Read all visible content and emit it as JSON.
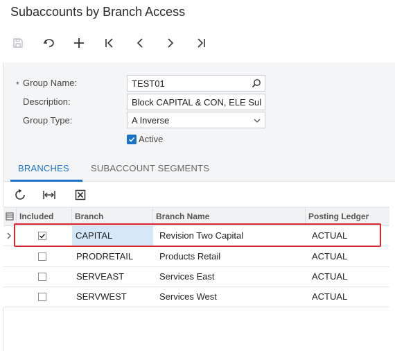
{
  "page": {
    "title": "Subaccounts by Branch Access"
  },
  "toolbar": {
    "buttons": [
      {
        "name": "save-icon",
        "enabled": false
      },
      {
        "name": "undo-icon",
        "enabled": true
      },
      {
        "name": "add-icon",
        "enabled": true
      },
      {
        "name": "first-record-icon",
        "enabled": true
      },
      {
        "name": "previous-record-icon",
        "enabled": true
      },
      {
        "name": "next-record-icon",
        "enabled": true
      },
      {
        "name": "last-record-icon",
        "enabled": true
      }
    ]
  },
  "form": {
    "required_marker": "*",
    "group_name_label": "Group Name:",
    "group_name_value": "TEST01",
    "description_label": "Description:",
    "description_value": "Block CAPITAL & CON, ELE Sul",
    "group_type_label": "Group Type:",
    "group_type_value": "A Inverse",
    "active_label": "Active",
    "active_checked": true
  },
  "tabs": [
    {
      "label": "BRANCHES",
      "active": true
    },
    {
      "label": "SUBACCOUNT SEGMENTS",
      "active": false
    }
  ],
  "grid_toolbar": {
    "buttons": [
      "refresh-icon",
      "fit-columns-icon",
      "export-excel-icon"
    ]
  },
  "grid": {
    "columns": [
      "Included",
      "Branch",
      "Branch Name",
      "Posting Ledger"
    ],
    "rows": [
      {
        "included": true,
        "branch": "CAPITAL",
        "branch_name": "Revision Two Capital",
        "posting_ledger": "ACTUAL",
        "selected": true
      },
      {
        "included": false,
        "branch": "PRODRETAIL",
        "branch_name": "Products Retail",
        "posting_ledger": "ACTUAL",
        "selected": false
      },
      {
        "included": false,
        "branch": "SERVEAST",
        "branch_name": "Services East",
        "posting_ledger": "ACTUAL",
        "selected": false
      },
      {
        "included": false,
        "branch": "SERVWEST",
        "branch_name": "Services West",
        "posting_ledger": "ACTUAL",
        "selected": false
      }
    ]
  },
  "colors": {
    "accent": "#1a73c8",
    "highlight_border": "#d6262e",
    "selected_cell": "#d5e8f8"
  }
}
